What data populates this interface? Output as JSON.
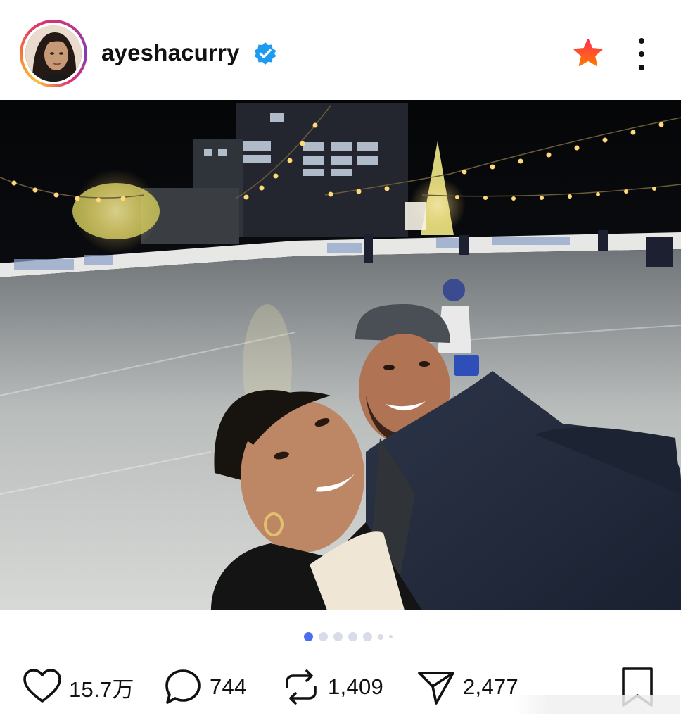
{
  "post": {
    "username": "ayeshacurry",
    "verified": true,
    "colors": {
      "accent": "#4e6cf0",
      "verified": "#1d9bf0",
      "star_top": "#ff2d55",
      "star_bottom": "#ff7a00"
    }
  },
  "header_icons": {
    "avatar": "avatar-photo",
    "verified": "verified-badge-icon",
    "favorite": "star-icon",
    "more": "more-vertical-icon"
  },
  "media": {
    "image": "selfie-at-outdoor-ice-rink-at-night",
    "carousel_total": 7,
    "carousel_current": 1
  },
  "actions": {
    "likes": "15.7万",
    "comments": "744",
    "reposts": "1,409",
    "shares": "2,477"
  },
  "action_icons": {
    "like": "heart-icon",
    "comment": "comment-bubble-icon",
    "repost": "repost-icon",
    "share": "send-icon",
    "bookmark": "bookmark-icon"
  }
}
